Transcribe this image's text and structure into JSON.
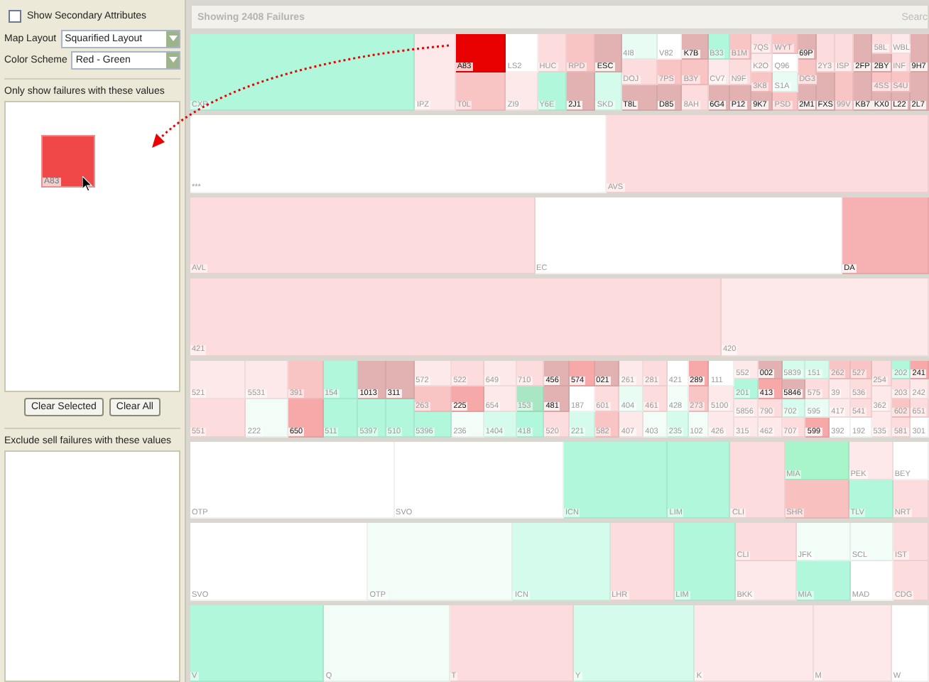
{
  "sidebar": {
    "secondary_attributes": {
      "label": "Show Secondary Attributes",
      "checked": false
    },
    "map_layout": {
      "label": "Map Layout",
      "value": "Squarified Layout"
    },
    "color_scheme": {
      "label": "Color Scheme",
      "value": "Red - Green"
    },
    "include_list": {
      "label": "Only show failures with these values",
      "items": [
        {
          "label": "A83",
          "color": "#f04848"
        }
      ]
    },
    "buttons": [
      "Clear Selected",
      "Clear All"
    ],
    "exclude_list": {
      "label": "Exclude sell failures with these values"
    }
  },
  "header": {
    "title": "Showing 2408 Failures",
    "search_placeholder": "Searc"
  },
  "treemap": {
    "rows": [
      {
        "items": [
          {
            "kind": "cell",
            "label": "CXR",
            "color": "#b0f7dc"
          },
          {
            "kind": "cell",
            "label": "IPZ",
            "color": "#fde9e9"
          },
          {
            "kind": "stack",
            "cells": [
              {
                "label": "A83",
                "color": "#e80000"
              },
              {
                "label": "T0L",
                "color": "#f9c4c4"
              }
            ]
          },
          {
            "kind": "stack",
            "cells": [
              {
                "label": "LS2",
                "color": "#ffffff"
              },
              {
                "label": "ZI9",
                "color": "#fde9e9"
              }
            ]
          },
          {
            "kind": "stack",
            "cells": [
              {
                "label": "HUC",
                "color": "#fcdcdc"
              },
              {
                "label": "Y6E",
                "color": "#b0f7dc"
              }
            ]
          },
          {
            "kind": "stack",
            "cells": [
              {
                "label": "RPD",
                "color": "#f9c4c4"
              },
              {
                "label": "2J1",
                "color": "#e2b2b2"
              }
            ]
          },
          {
            "kind": "stack",
            "cells": [
              {
                "label": "ESC",
                "color": "#e2b2b2"
              },
              {
                "label": "SKD",
                "color": "#d4fbec"
              }
            ]
          },
          {
            "kind": "stack",
            "cells": [
              {
                "label": "4I8",
                "color": "#e8fcf4"
              },
              {
                "label": "DOJ",
                "color": "#fcdcdc"
              },
              {
                "label": "T8L",
                "color": "#e2b2b2"
              }
            ]
          },
          {
            "kind": "stack",
            "cells": [
              {
                "label": "V82",
                "color": "#ffffff"
              },
              {
                "label": "7PS",
                "color": "#f9c4c4"
              },
              {
                "label": "D85",
                "color": "#e2b2b2"
              }
            ]
          },
          {
            "kind": "stack",
            "cells": [
              {
                "label": "K7B",
                "color": "#e2b2b2"
              },
              {
                "label": "B3Y",
                "color": "#f9c4c4"
              },
              {
                "label": "8AH",
                "color": "#fcdcdc"
              }
            ]
          },
          {
            "kind": "stack",
            "cells": [
              {
                "label": "B33",
                "color": "#b0f7dc"
              },
              {
                "label": "CV7",
                "color": "#fde9e9"
              },
              {
                "label": "6G4",
                "color": "#e2b2b2"
              }
            ]
          },
          {
            "kind": "stack",
            "cells": [
              {
                "label": "B1M",
                "color": "#f9c4c4"
              },
              {
                "label": "N9F",
                "color": "#fcdcdc"
              },
              {
                "label": "P12",
                "color": "#e2b2b2"
              }
            ]
          },
          {
            "kind": "stack",
            "cells": [
              {
                "label": "7QS",
                "color": "#fcdcdc"
              },
              {
                "label": "K2O",
                "color": "#fde9e9"
              },
              {
                "label": "3K8",
                "color": "#f9c4c4"
              },
              {
                "label": "9K7",
                "color": "#e2b2b2"
              }
            ]
          },
          {
            "kind": "stack",
            "cells": [
              {
                "label": "WYT",
                "color": "#f9c4c4"
              },
              {
                "label": "Q96",
                "color": "#ffffff"
              },
              {
                "label": "S1A",
                "color": "#e8fcf4"
              },
              {
                "label": "PSD",
                "color": "#f9c4c4"
              }
            ]
          },
          {
            "kind": "stack",
            "cells": [
              {
                "label": "69P",
                "color": "#e2b2b2"
              },
              {
                "label": "DG3",
                "color": "#f9c4c4"
              },
              {
                "label": "2M1",
                "color": "#e2b2b2"
              }
            ]
          },
          {
            "kind": "stack",
            "cells": [
              {
                "label": "2Y3",
                "color": "#fcdcdc"
              },
              {
                "label": "FXS",
                "color": "#e2b2b2"
              }
            ]
          },
          {
            "kind": "stack",
            "cells": [
              {
                "label": "ISP",
                "color": "#fcdcdc"
              },
              {
                "label": "99V",
                "color": "#f9c4c4"
              }
            ]
          },
          {
            "kind": "stack",
            "cells": [
              {
                "label": "2FP",
                "color": "#e2b2b2"
              },
              {
                "label": "KB7",
                "color": "#e2b2b2"
              }
            ]
          },
          {
            "kind": "stack",
            "cells": [
              {
                "label": "58L",
                "color": "#fcdcdc"
              },
              {
                "label": "2BY",
                "color": "#e2b2b2"
              },
              {
                "label": "4SS",
                "color": "#f9c4c4"
              },
              {
                "label": "KX0",
                "color": "#e2b2b2"
              }
            ]
          },
          {
            "kind": "stack",
            "cells": [
              {
                "label": "WBL",
                "color": "#fde9e9"
              },
              {
                "label": "INF",
                "color": "#fcdcdc"
              },
              {
                "label": "S4U",
                "color": "#f9c4c4"
              },
              {
                "label": "L22",
                "color": "#e2b2b2"
              }
            ]
          },
          {
            "kind": "stack",
            "cells": [
              {
                "label": "9H7",
                "color": "#e2b2b2"
              },
              {
                "label": "2L7",
                "color": "#e2b2b2"
              }
            ]
          }
        ]
      },
      {
        "items": [
          {
            "kind": "cell",
            "label": "***",
            "color": "#ffffff"
          },
          {
            "kind": "cell",
            "label": "AVS",
            "color": "#fcdcdc"
          }
        ]
      },
      {
        "items": [
          {
            "kind": "cell",
            "label": "AVL",
            "color": "#fcdcdc"
          },
          {
            "kind": "cell",
            "label": "EC",
            "color": "#ffffff"
          },
          {
            "kind": "cell",
            "label": "DA",
            "color": "#f6b2b2"
          }
        ]
      },
      {
        "items": [
          {
            "kind": "cell",
            "label": "421",
            "color": "#fcdcdc"
          },
          {
            "kind": "cell",
            "label": "420",
            "color": "#fde9e9"
          }
        ]
      },
      {
        "items": [
          {
            "kind": "stack",
            "cells": [
              {
                "label": "521",
                "color": "#fde9e9"
              },
              {
                "label": "551",
                "color": "#fcdcdc"
              }
            ]
          },
          {
            "kind": "stack",
            "cells": [
              {
                "label": "5531",
                "color": "#fde9e9"
              },
              {
                "label": "222",
                "color": "#f2fdf8"
              }
            ]
          },
          {
            "kind": "stack",
            "cells": [
              {
                "label": "391",
                "color": "#f9c4c4"
              },
              {
                "label": "650",
                "color": "#f7a8a8"
              }
            ]
          },
          {
            "kind": "stack",
            "cells": [
              {
                "label": "154",
                "color": "#b0f7dc"
              },
              {
                "label": "511",
                "color": "#b0f7dc"
              }
            ]
          },
          {
            "kind": "stack",
            "cells": [
              {
                "label": "1013",
                "color": "#e2b2b2"
              },
              {
                "label": "5397",
                "color": "#b0f7dc"
              }
            ]
          },
          {
            "kind": "stack",
            "cells": [
              {
                "label": "311",
                "color": "#e2b2b2"
              },
              {
                "label": "510",
                "color": "#b0f7dc"
              }
            ]
          },
          {
            "kind": "stack",
            "cells": [
              {
                "label": "572",
                "color": "#fde9e9"
              },
              {
                "label": "263",
                "color": "#f9c4c4"
              },
              {
                "label": "5396",
                "color": "#b0f7dc"
              }
            ]
          },
          {
            "kind": "stack",
            "cells": [
              {
                "label": "522",
                "color": "#fcdcdc"
              },
              {
                "label": "225",
                "color": "#f7a8a8"
              },
              {
                "label": "236",
                "color": "#f2fdf8"
              }
            ]
          },
          {
            "kind": "stack",
            "cells": [
              {
                "label": "649",
                "color": "#fde9e9"
              },
              {
                "label": "654",
                "color": "#fde9e9"
              },
              {
                "label": "1404",
                "color": "#d4fbec"
              }
            ]
          },
          {
            "kind": "stack",
            "cells": [
              {
                "label": "710",
                "color": "#fcdcdc"
              },
              {
                "label": "153",
                "color": "#a8e6c4"
              },
              {
                "label": "418",
                "color": "#b0f7dc"
              }
            ]
          },
          {
            "kind": "stack",
            "cells": [
              {
                "label": "456",
                "color": "#e2b2b2"
              },
              {
                "label": "481",
                "color": "#e2b2b2"
              },
              {
                "label": "520",
                "color": "#fcdcdc"
              }
            ]
          },
          {
            "kind": "stack",
            "cells": [
              {
                "label": "574",
                "color": "#f7a8a8"
              },
              {
                "label": "187",
                "color": "#ffffff"
              },
              {
                "label": "221",
                "color": "#d4fbec"
              }
            ]
          },
          {
            "kind": "stack",
            "cells": [
              {
                "label": "021",
                "color": "#e2b2b2"
              },
              {
                "label": "601",
                "color": "#fcdcdc"
              },
              {
                "label": "582",
                "color": "#f9c4c4"
              }
            ]
          },
          {
            "kind": "stack",
            "cells": [
              {
                "label": "261",
                "color": "#fde9e9"
              },
              {
                "label": "404",
                "color": "#e8fcf4"
              },
              {
                "label": "407",
                "color": "#fde9e9"
              }
            ]
          },
          {
            "kind": "stack",
            "cells": [
              {
                "label": "281",
                "color": "#fcdcdc"
              },
              {
                "label": "461",
                "color": "#fcdcdc"
              },
              {
                "label": "403",
                "color": "#f2fdf8"
              }
            ]
          },
          {
            "kind": "stack",
            "cells": [
              {
                "label": "421",
                "color": "#ffffff"
              },
              {
                "label": "428",
                "color": "#f2fdf8"
              },
              {
                "label": "235",
                "color": "#d4fbec"
              }
            ]
          },
          {
            "kind": "stack",
            "cells": [
              {
                "label": "289",
                "color": "#f7a8a8"
              },
              {
                "label": "273",
                "color": "#f9c4c4"
              },
              {
                "label": "102",
                "color": "#f2fdf8"
              }
            ]
          },
          {
            "kind": "stack",
            "cells": [
              {
                "label": "111",
                "color": "#ffffff"
              },
              {
                "label": "5100",
                "color": "#fde9e9"
              },
              {
                "label": "426",
                "color": "#fde9e9"
              }
            ]
          },
          {
            "kind": "stack",
            "cells": [
              {
                "label": "552",
                "color": "#fde9e9"
              },
              {
                "label": "201",
                "color": "#b0f7dc"
              },
              {
                "label": "5856",
                "color": "#fde9e9"
              },
              {
                "label": "315",
                "color": "#fde9e9"
              }
            ]
          },
          {
            "kind": "stack",
            "cells": [
              {
                "label": "002",
                "color": "#e2b2b2"
              },
              {
                "label": "413",
                "color": "#f7a8a8"
              },
              {
                "label": "790",
                "color": "#fcdcdc"
              },
              {
                "label": "462",
                "color": "#fde9e9"
              }
            ]
          },
          {
            "kind": "stack",
            "cells": [
              {
                "label": "5839",
                "color": "#d4fbec"
              },
              {
                "label": "5846",
                "color": "#e2b2b2"
              },
              {
                "label": "702",
                "color": "#d4fbec"
              },
              {
                "label": "707",
                "color": "#fcdcdc"
              }
            ]
          },
          {
            "kind": "stack",
            "cells": [
              {
                "label": "151",
                "color": "#d4fbec"
              },
              {
                "label": "575",
                "color": "#fcdcdc"
              },
              {
                "label": "595",
                "color": "#e8fcf4"
              },
              {
                "label": "599",
                "color": "#f7a8a8"
              }
            ]
          },
          {
            "kind": "stack",
            "cells": [
              {
                "label": "262",
                "color": "#f9c4c4"
              },
              {
                "label": "39",
                "color": "#fde9e9"
              },
              {
                "label": "417",
                "color": "#fde9e9"
              },
              {
                "label": "392",
                "color": "#ffffff"
              }
            ]
          },
          {
            "kind": "stack",
            "cells": [
              {
                "label": "527",
                "color": "#f9c4c4"
              },
              {
                "label": "536",
                "color": "#fcdcdc"
              },
              {
                "label": "541",
                "color": "#fcdcdc"
              },
              {
                "label": "192",
                "color": "#ffffff"
              }
            ]
          },
          {
            "kind": "stack",
            "cells": [
              {
                "label": "254",
                "color": "#fcdcdc"
              },
              {
                "label": "362",
                "color": "#fde9e9"
              },
              {
                "label": "535",
                "color": "#fde9e9"
              }
            ]
          },
          {
            "kind": "stack",
            "cells": [
              {
                "label": "202",
                "color": "#b0f7dc"
              },
              {
                "label": "203",
                "color": "#fcdcdc"
              },
              {
                "label": "602",
                "color": "#f9c4c4"
              },
              {
                "label": "581",
                "color": "#fcdcdc"
              }
            ]
          },
          {
            "kind": "stack",
            "cells": [
              {
                "label": "241",
                "color": "#f7a8a8"
              },
              {
                "label": "242",
                "color": "#fde9e9"
              },
              {
                "label": "651",
                "color": "#fcdcdc"
              },
              {
                "label": "301",
                "color": "#ffffff"
              }
            ]
          }
        ]
      },
      {
        "items": [
          {
            "kind": "cell",
            "label": "OTP",
            "color": "#ffffff"
          },
          {
            "kind": "cell",
            "label": "SVO",
            "color": "#ffffff"
          },
          {
            "kind": "cell",
            "label": "ICN",
            "color": "#b0f7dc"
          },
          {
            "kind": "cell",
            "label": "LIM",
            "color": "#b0f7dc"
          },
          {
            "kind": "cell",
            "label": "CLI",
            "color": "#fcdcdc"
          },
          {
            "kind": "stack",
            "cells": [
              {
                "label": "MIA",
                "color": "#a8f5cc"
              },
              {
                "label": "SHR",
                "color": "#f9c0c0"
              }
            ]
          },
          {
            "kind": "stack",
            "cells": [
              {
                "label": "PEK",
                "color": "#fde9e9"
              },
              {
                "label": "TLV",
                "color": "#b0f7dc"
              }
            ]
          },
          {
            "kind": "stack",
            "cells": [
              {
                "label": "BEY",
                "color": "#ffffff"
              },
              {
                "label": "NRT",
                "color": "#fcdcdc"
              }
            ]
          }
        ]
      },
      {
        "items": [
          {
            "kind": "cell",
            "label": "SVO",
            "color": "#ffffff"
          },
          {
            "kind": "cell",
            "label": "OTP",
            "color": "#f2fdf8"
          },
          {
            "kind": "cell",
            "label": "ICN",
            "color": "#d4fbec"
          },
          {
            "kind": "cell",
            "label": "LHR",
            "color": "#fcdcdc"
          },
          {
            "kind": "cell",
            "label": "LIM",
            "color": "#b0f7dc"
          },
          {
            "kind": "stack",
            "cells": [
              {
                "label": "CLI",
                "color": "#fcdcdc"
              },
              {
                "label": "BKK",
                "color": "#fde9e9"
              }
            ]
          },
          {
            "kind": "stack",
            "cells": [
              {
                "label": "JFK",
                "color": "#f2fdf8"
              },
              {
                "label": "MIA",
                "color": "#b0f7dc"
              }
            ]
          },
          {
            "kind": "stack",
            "cells": [
              {
                "label": "SCL",
                "color": "#f2fdf8"
              },
              {
                "label": "MAD",
                "color": "#ffffff"
              }
            ]
          },
          {
            "kind": "stack",
            "cells": [
              {
                "label": "IST",
                "color": "#fcdcdc"
              },
              {
                "label": "CDG",
                "color": "#fcdcdc"
              }
            ]
          }
        ]
      },
      {
        "items": [
          {
            "kind": "cell",
            "label": "V",
            "color": "#b0f7dc"
          },
          {
            "kind": "cell",
            "label": "Q",
            "color": "#f2fdf8"
          },
          {
            "kind": "cell",
            "label": "T",
            "color": "#fcdcdc"
          },
          {
            "kind": "cell",
            "label": "Y",
            "color": "#d4fbec"
          },
          {
            "kind": "cell",
            "label": "K",
            "color": "#fde9e9"
          },
          {
            "kind": "cell",
            "label": "M",
            "color": "#fde9e9"
          },
          {
            "kind": "cell",
            "label": "W",
            "color": "#ffffff"
          }
        ]
      }
    ]
  }
}
